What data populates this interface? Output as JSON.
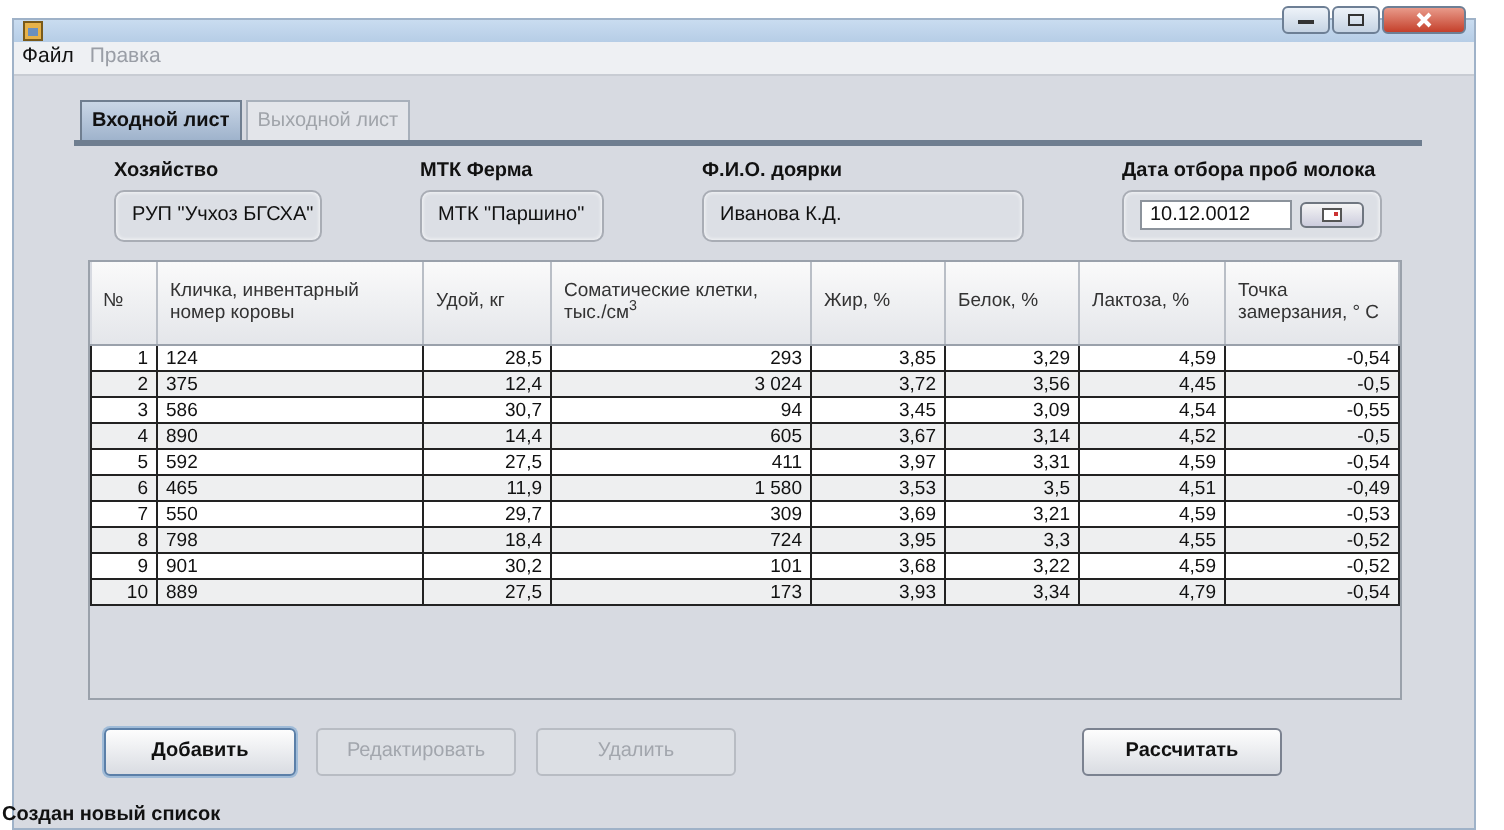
{
  "menu": [
    {
      "label": "Файл",
      "disabled": false
    },
    {
      "label": "Правка",
      "disabled": true
    }
  ],
  "tabs": [
    {
      "label": "Входной лист",
      "selected": true
    },
    {
      "label": "Выходной лист",
      "selected": false
    }
  ],
  "fields": [
    {
      "label": "Хозяйство",
      "value": "РУП \"Учхоз БГСХА\"",
      "kind": "text"
    },
    {
      "label": "МТК Ферма",
      "value": "МТК \"Паршино\"",
      "kind": "text"
    },
    {
      "label": "Ф.И.О. доярки",
      "value": "Иванова К.Д.",
      "kind": "text"
    },
    {
      "label": "Дата отбора проб молока",
      "value": "10.12.0012",
      "kind": "date"
    }
  ],
  "table": {
    "columns": [
      "№",
      "Кличка, инвентарный номер коровы",
      "Удой, кг",
      "Соматические клетки, тыс./см$^{3}$",
      "Жир, %",
      "Белок, %",
      "Лактоза, %",
      "Точка замерзания, ° C"
    ],
    "rows": [
      [
        "1",
        "124",
        "28,5",
        "293",
        "3,85",
        "3,29",
        "4,59",
        "-0,54"
      ],
      [
        "2",
        "375",
        "12,4",
        "3 024",
        "3,72",
        "3,56",
        "4,45",
        "-0,5"
      ],
      [
        "3",
        "586",
        "30,7",
        "94",
        "3,45",
        "3,09",
        "4,54",
        "-0,55"
      ],
      [
        "4",
        "890",
        "14,4",
        "605",
        "3,67",
        "3,14",
        "4,52",
        "-0,5"
      ],
      [
        "5",
        "592",
        "27,5",
        "411",
        "3,97",
        "3,31",
        "4,59",
        "-0,54"
      ],
      [
        "6",
        "465",
        "11,9",
        "1 580",
        "3,53",
        "3,5",
        "4,51",
        "-0,49"
      ],
      [
        "7",
        "550",
        "29,7",
        "309",
        "3,69",
        "3,21",
        "4,59",
        "-0,53"
      ],
      [
        "8",
        "798",
        "18,4",
        "724",
        "3,95",
        "3,3",
        "4,55",
        "-0,52"
      ],
      [
        "9",
        "901",
        "30,2",
        "101",
        "3,68",
        "3,22",
        "4,59",
        "-0,52"
      ],
      [
        "10",
        "889",
        "27,5",
        "173",
        "3,93",
        "3,34",
        "4,79",
        "-0,54"
      ]
    ]
  },
  "buttons": [
    {
      "label": "Добавить",
      "disabled": false,
      "focused": true
    },
    {
      "label": "Редактировать",
      "disabled": true,
      "focused": false
    },
    {
      "label": "Удалить",
      "disabled": true,
      "focused": false
    },
    {
      "label": "Рассчитать",
      "disabled": false,
      "focused": false
    }
  ],
  "status_bar": "Создан новый список"
}
